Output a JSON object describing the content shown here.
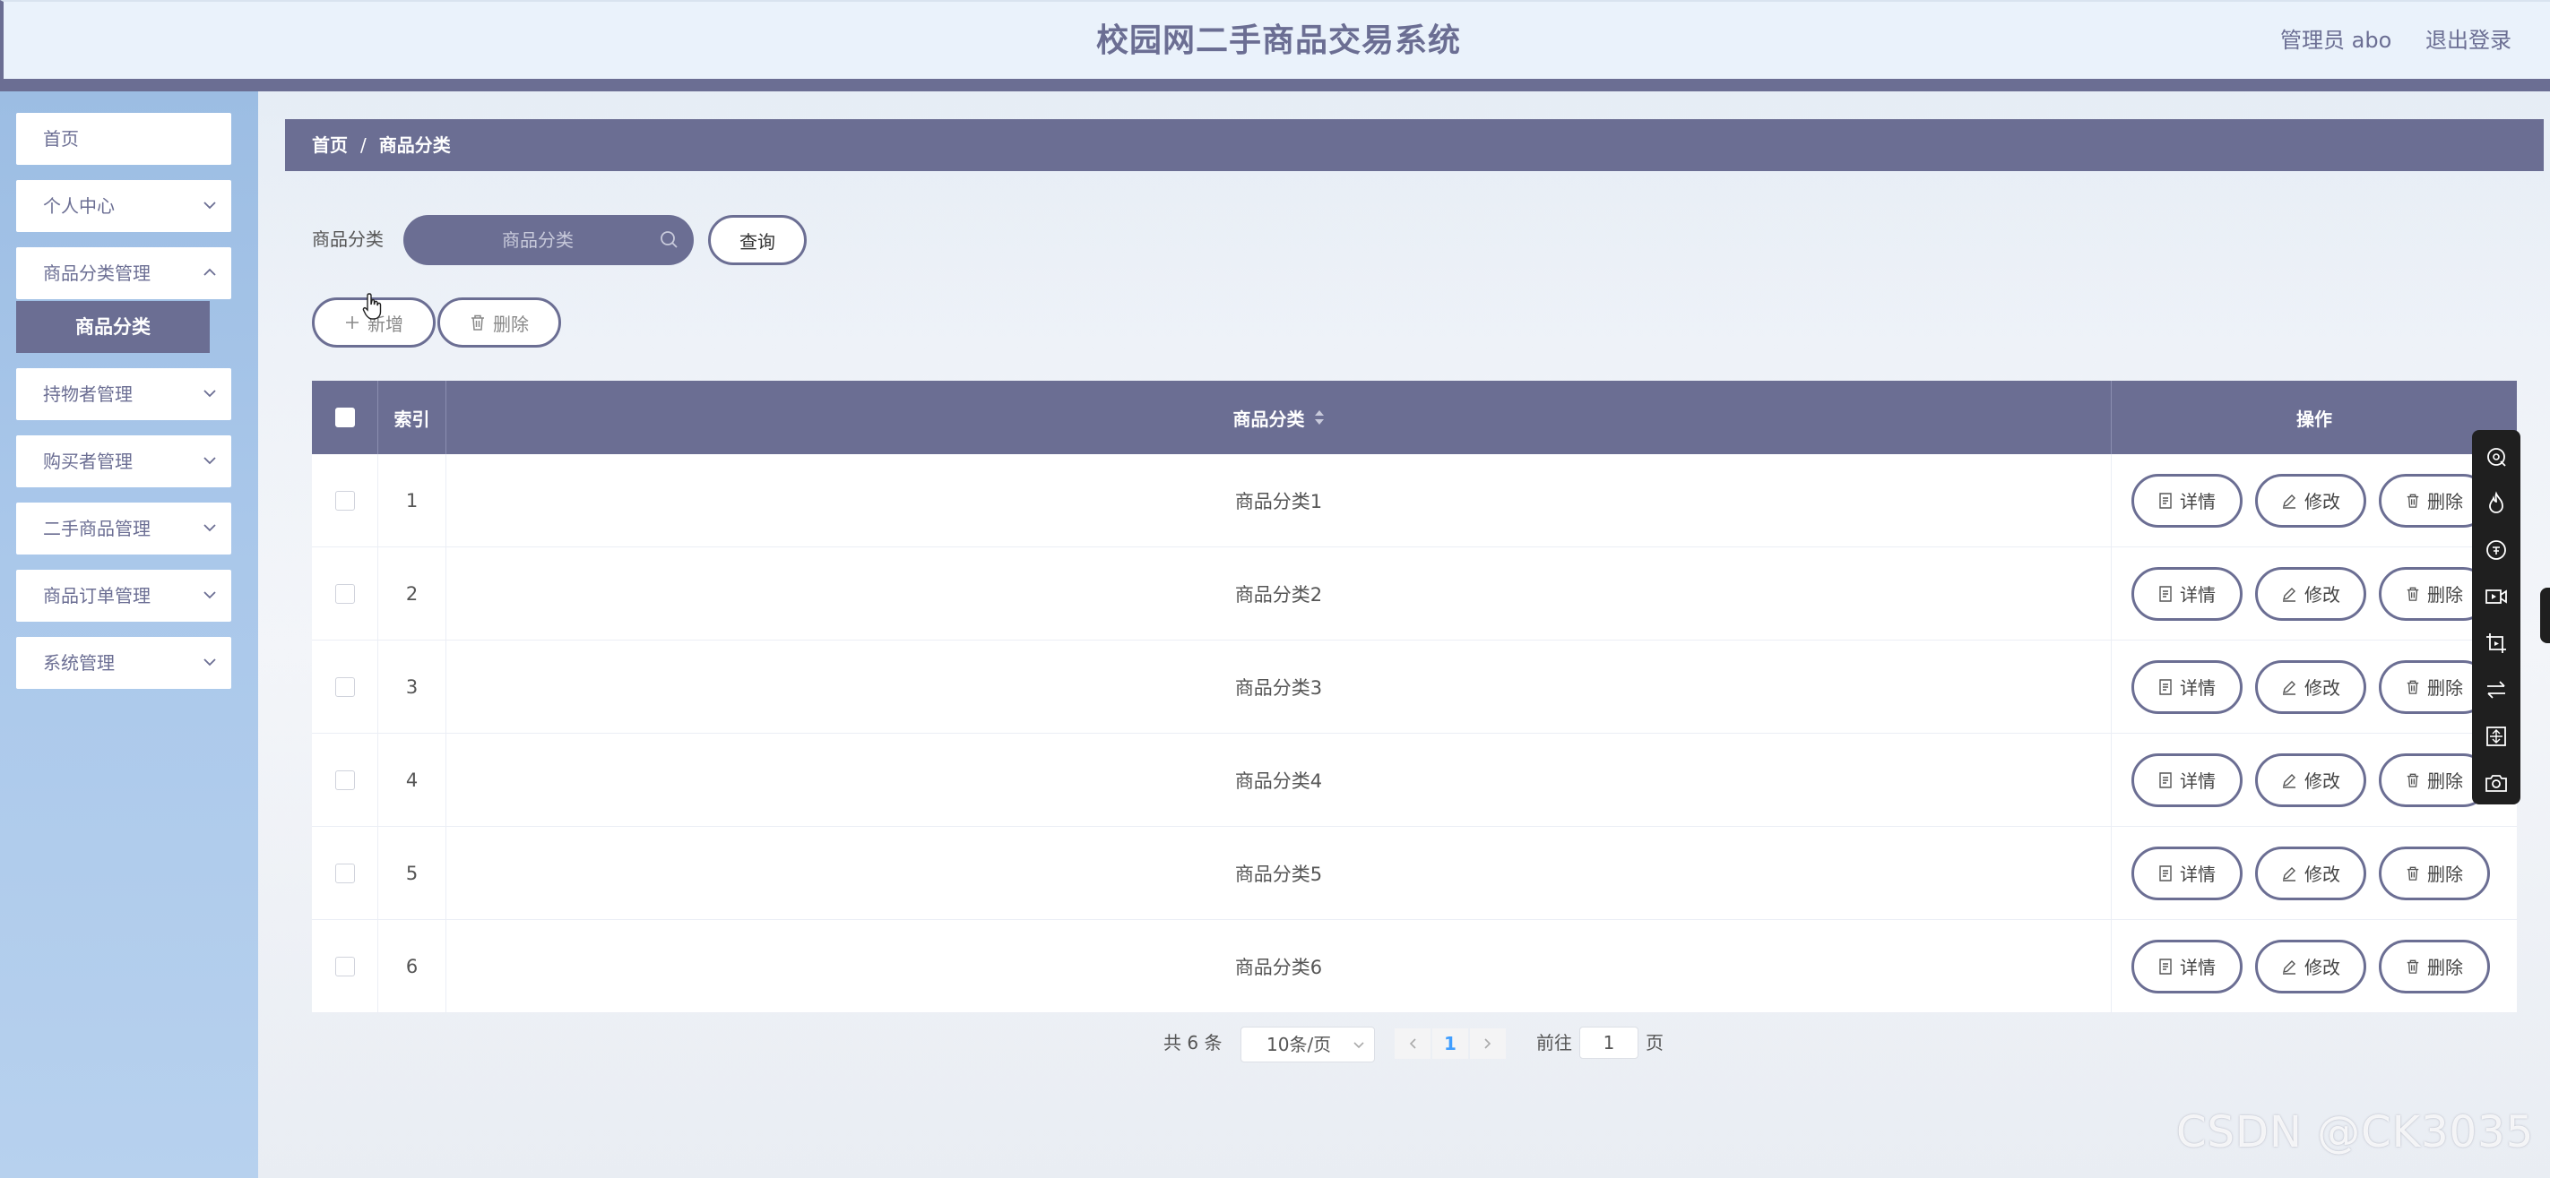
{
  "header": {
    "title": "校园网二手商品交易系统",
    "user": "管理员 abo",
    "logout": "退出登录"
  },
  "sidebar": {
    "items": [
      {
        "label": "首页"
      },
      {
        "label": "个人中心"
      },
      {
        "label": "商品分类管理"
      },
      {
        "label": "持物者管理"
      },
      {
        "label": "购买者管理"
      },
      {
        "label": "二手商品管理"
      },
      {
        "label": "商品订单管理"
      },
      {
        "label": "系统管理"
      }
    ],
    "active_sub": "商品分类"
  },
  "breadcrumb": {
    "home": "首页",
    "sep": "/",
    "current": "商品分类"
  },
  "search": {
    "label": "商品分类",
    "placeholder": "商品分类",
    "button": "查询"
  },
  "toolbar": {
    "add": "新增",
    "delete": "删除"
  },
  "table": {
    "columns": {
      "index": "索引",
      "name": "商品分类",
      "ops": "操作"
    },
    "rows": [
      {
        "index": "1",
        "name": "商品分类1"
      },
      {
        "index": "2",
        "name": "商品分类2"
      },
      {
        "index": "3",
        "name": "商品分类3"
      },
      {
        "index": "4",
        "name": "商品分类4"
      },
      {
        "index": "5",
        "name": "商品分类5"
      },
      {
        "index": "6",
        "name": "商品分类6"
      }
    ],
    "actions": {
      "detail": "详情",
      "edit": "修改",
      "delete": "删除"
    }
  },
  "pagination": {
    "total": "共 6 条",
    "page_size": "10条/页",
    "current": "1",
    "goto_label": "前往",
    "goto_value": "1",
    "page_suffix": "页"
  },
  "watermark": "CSDN @CK3035",
  "colors": {
    "accent": "#6b6e93",
    "sidebar": "#a9c7ea",
    "header_bg": "#eaf2fb"
  }
}
